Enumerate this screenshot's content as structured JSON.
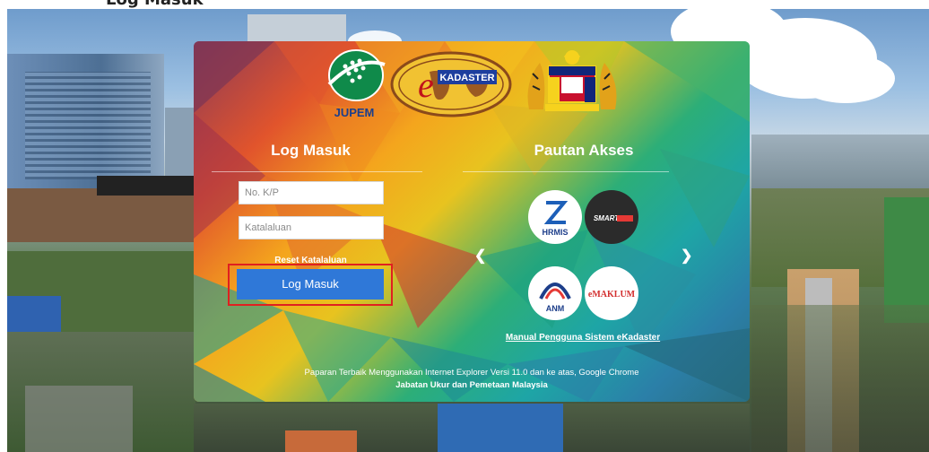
{
  "caption": "Log Masuk",
  "logos": {
    "jupem_text": "JUPEM",
    "ekadaster_text": "KADASTER"
  },
  "login": {
    "heading": "Log Masuk",
    "id_placeholder": "No. K/P",
    "password_placeholder": "Katalaluan",
    "reset_label": "Reset Katalaluan",
    "submit_label": "Log Masuk"
  },
  "access": {
    "heading": "Pautan Akses",
    "links": [
      {
        "label": "HRMIS"
      },
      {
        "label": "SMART"
      },
      {
        "label": "ANM"
      },
      {
        "label": "eMAKLUM"
      }
    ],
    "manual_label": "Manual Pengguna Sistem eKadaster"
  },
  "footer": {
    "browser_note": "Paparan Terbaik Menggunakan Internet Explorer Versi 11.0 dan ke atas, Google Chrome",
    "org_name": "Jabatan Ukur dan Pemetaan Malaysia"
  },
  "colors": {
    "login_button": "#2f78d8",
    "highlight_box": "#e02020"
  }
}
